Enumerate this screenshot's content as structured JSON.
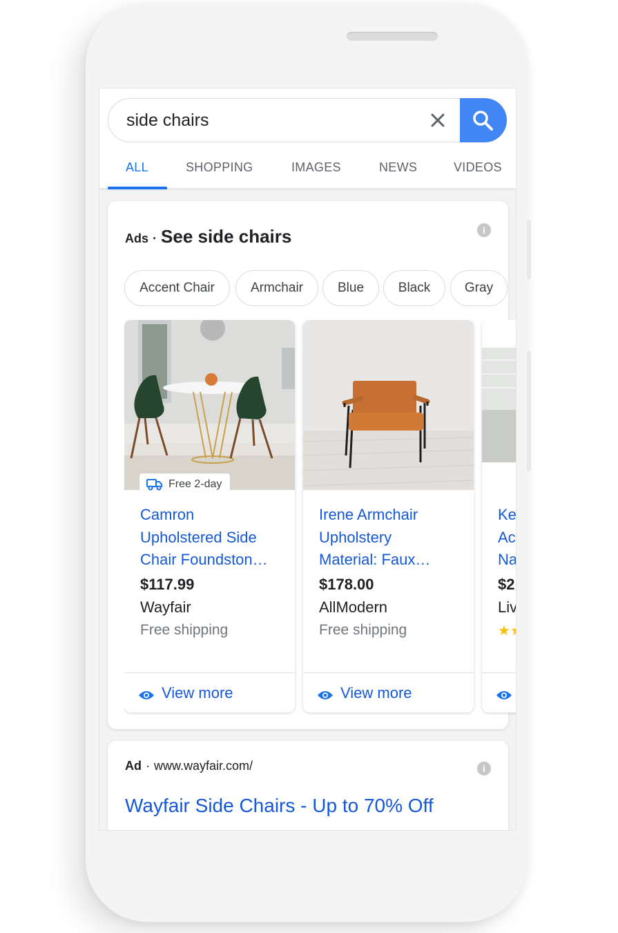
{
  "search": {
    "query": "side chairs"
  },
  "tabs": [
    "ALL",
    "SHOPPING",
    "IMAGES",
    "NEWS",
    "VIDEOS"
  ],
  "ads_block": {
    "tag": "Ads",
    "title": "See side chairs"
  },
  "chips": [
    "Accent Chair",
    "Armchair",
    "Blue",
    "Black",
    "Gray"
  ],
  "products": [
    {
      "title_lines": [
        "Camron",
        "Upholstered Side",
        "Chair Foundston…"
      ],
      "price": "$117.99",
      "seller": "Wayfair",
      "shipping": "Free shipping",
      "badge": "Free 2-day",
      "action": "View more"
    },
    {
      "title_lines": [
        "Irene Armchair",
        "Upholstery",
        "Material: Faux…"
      ],
      "price": "$178.00",
      "seller": "AllModern",
      "shipping": "Free shipping",
      "action": "View more"
    },
    {
      "title_lines": [
        "Ke",
        "Ac",
        "Na"
      ],
      "price": "$2",
      "seller": "Liv",
      "rating_stars": 2
    }
  ],
  "ad_result": {
    "tag": "Ad",
    "url": "www.wayfair.com/",
    "title": "Wayfair Side Chairs - Up to 70% Off"
  },
  "colors": {
    "accent": "#1a73e8",
    "search_button": "#4285f4",
    "link": "#1558d6",
    "star": "#fbbc04"
  },
  "icons": [
    "clear-icon",
    "search-icon",
    "info-icon",
    "truck-icon",
    "eye-icon",
    "star-icon"
  ]
}
